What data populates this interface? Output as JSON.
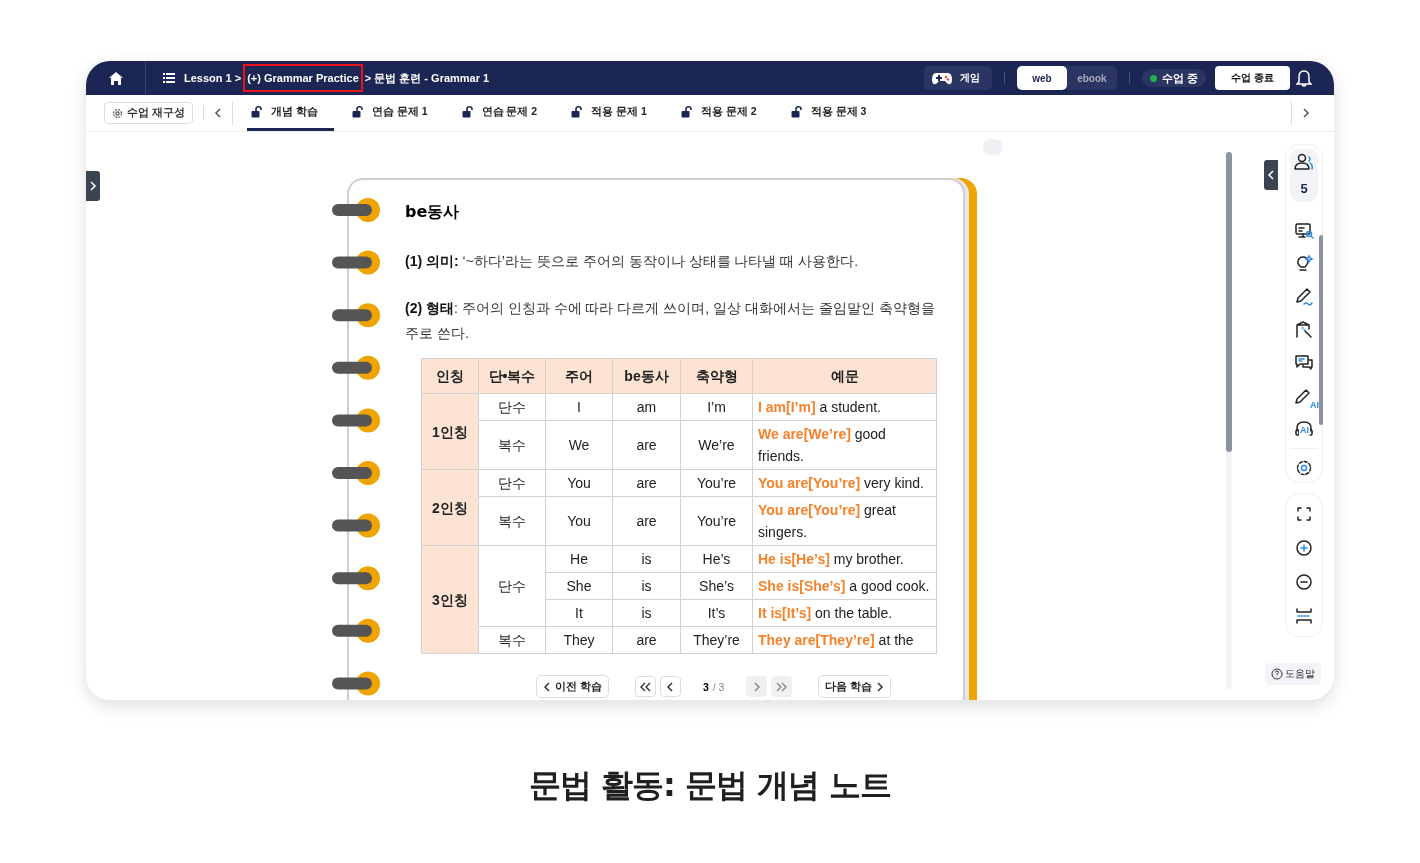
{
  "header": {
    "breadcrumb": [
      {
        "text": "Lesson 1 >",
        "highlighted": false
      },
      {
        "text": "(+) Grammar Practice",
        "highlighted": true
      },
      {
        "text": "> 문법 훈련 - Grammar 1",
        "highlighted": false
      }
    ],
    "game_button": "게임",
    "view_modes": [
      {
        "label": "web",
        "selected": true
      },
      {
        "label": "ebook",
        "selected": false
      }
    ],
    "status": "수업 중",
    "end_button": "수업 종료"
  },
  "toolbar": {
    "reset_button": "수업 재구성",
    "tabs": [
      {
        "label": "개념 학습",
        "selected": true
      },
      {
        "label": "연습 문제 1",
        "selected": false
      },
      {
        "label": "연습 문제 2",
        "selected": false
      },
      {
        "label": "적용 문제 1",
        "selected": false
      },
      {
        "label": "적용 문제 2",
        "selected": false
      },
      {
        "label": "적용 문제 3",
        "selected": false
      }
    ]
  },
  "note": {
    "title": "be동사",
    "paragraphs": [
      "**(1) 의미:** ‘~하다’라는 뜻으로 주어의 동작이나 상태를 나타낼 때 사용한다.",
      "**(2) 형태**: 주어의 인칭과 수에 따라 다르게 쓰이며, 일상 대화에서는 줄임말인 축약형을 주로 쓴다."
    ],
    "table": {
      "columns": [
        "인칭",
        "단•복수",
        "주어",
        "be동사",
        "축약형",
        "예문"
      ],
      "groups": [
        {
          "person": "1인칭",
          "numbers": [
            {
              "number": "단수",
              "rows": [
                {
                  "subject": "I",
                  "be": "am",
                  "contraction": "I’m",
                  "example": "**I am[I’m]** a student."
                }
              ]
            },
            {
              "number": "복수",
              "rows": [
                {
                  "subject": "We",
                  "be": "are",
                  "contraction": "We’re",
                  "example": "**We are[We’re]** good friends."
                }
              ]
            }
          ]
        },
        {
          "person": "2인칭",
          "numbers": [
            {
              "number": "단수",
              "rows": [
                {
                  "subject": "You",
                  "be": "are",
                  "contraction": "You’re",
                  "example": "**You are[You’re]** very kind."
                }
              ]
            },
            {
              "number": "복수",
              "rows": [
                {
                  "subject": "You",
                  "be": "are",
                  "contraction": "You’re",
                  "example": "**You are[You’re]** great singers."
                }
              ]
            }
          ]
        },
        {
          "person": "3인칭",
          "numbers": [
            {
              "number": "단수",
              "rows": [
                {
                  "subject": "He",
                  "be": "is",
                  "contraction": "He’s",
                  "example": "**He is[He’s]** my brother."
                },
                {
                  "subject": "She",
                  "be": "is",
                  "contraction": "She’s",
                  "example": "**She is[She’s]** a good cook."
                },
                {
                  "subject": "It",
                  "be": "is",
                  "contraction": "It’s",
                  "example": "**It is[It’s]** on the table."
                }
              ]
            },
            {
              "number": "복수",
              "rows": [
                {
                  "subject": "They",
                  "be": "are",
                  "contraction": "They’re",
                  "example": "**They are[They’re]** at the"
                }
              ]
            }
          ]
        }
      ]
    }
  },
  "pager": {
    "prev_button": "이전 학습",
    "next_button": "다음 학습",
    "page": "3",
    "total": "/ 3",
    "nav": [
      {
        "kind": "first",
        "disabled": false
      },
      {
        "kind": "prev",
        "disabled": false
      },
      {
        "kind": "next",
        "disabled": true
      },
      {
        "kind": "last",
        "disabled": true
      }
    ]
  },
  "rail": {
    "participants": "5",
    "pen_badge": "AI",
    "headset_badge": "AI",
    "help_button": "도움말"
  },
  "caption": "문법 활동: 문법 개념 노트"
}
